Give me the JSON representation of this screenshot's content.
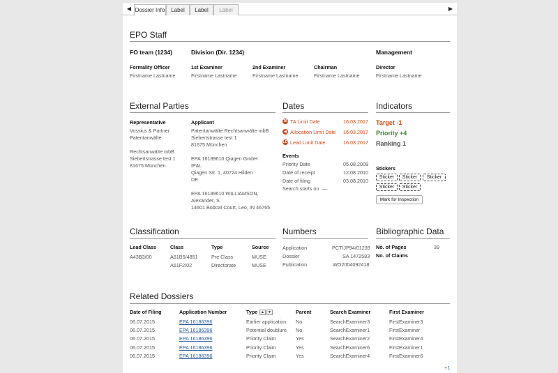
{
  "tabs": {
    "items": [
      "Dossier Info",
      "Label",
      "Label",
      "Label"
    ]
  },
  "epo_staff": {
    "heading": "EPO Staff",
    "fo_team": "FO team (1234)",
    "division": "Division (Dir. 1234)",
    "management": "Management",
    "roles": [
      {
        "role": "Formality Officer",
        "name": "Firstname Lastname"
      },
      {
        "role": "1st Examiner",
        "name": "Firstname Lastname"
      },
      {
        "role": "2nd Examiner",
        "name": "Firstname Lastname"
      },
      {
        "role": "Chairman",
        "name": "Firstname Lastname"
      },
      {
        "role": "Director",
        "name": "Firstname Lastname"
      }
    ]
  },
  "external_parties": {
    "heading": "External Parties",
    "representative": {
      "label": "Representative",
      "lines": [
        "Vossius & Partner",
        "Patentanwälte",
        "",
        "Rechtsanwälte mbB",
        "Siebertstrasse test 1",
        "81675 München"
      ]
    },
    "applicant": {
      "label": "Applicant",
      "lines": [
        "Patentanwälte Rechtsanwälte mbB",
        "Siebertstrasse test 1",
        "81675 München",
        "",
        "EPA 16189610 Qiagen GmbH",
        "IP&L",
        "Qiagen Str. 1, 40724 Hilden",
        "DE",
        "",
        "EPA 16189610 WILLIAMSON,",
        "Alexander, S.",
        "14601 Bobcat Court, Leo, IN 46765"
      ]
    }
  },
  "dates": {
    "heading": "Dates",
    "limits": [
      {
        "icon": "TA",
        "label": "TA Limit Date",
        "value": "16.03.2017"
      },
      {
        "icon": "◀",
        "label": "Allocation Limit Date",
        "value": "16.03.2017"
      },
      {
        "icon": "LD",
        "label": "Lead Limit Date",
        "value": "16.03.2017"
      }
    ],
    "events_label": "Events",
    "events": [
      {
        "label": "Priority Date",
        "value": "05.08.2009"
      },
      {
        "label": "Date of receipt",
        "value": "12.08.2010"
      },
      {
        "label": "Date of filing",
        "value": "03.08.2010"
      },
      {
        "label": "Search starts on",
        "value": "—"
      }
    ]
  },
  "indicators": {
    "heading": "Indicators",
    "target": "Target -1",
    "priority": "Priority +4",
    "ranking": "Ranking 1",
    "stickers_label": "Stickers",
    "stickers": [
      "Sticker",
      "Sticker",
      "Sticker",
      "Sticker",
      "Sticker"
    ],
    "mark_button": "Mark for Inspection"
  },
  "classification": {
    "heading": "Classification",
    "columns": [
      "Lead Class",
      "Class",
      "Type",
      "Source"
    ],
    "lead_class": "A43B3/00",
    "rows": [
      {
        "class": "A61B5/4851",
        "type": "Pre Class",
        "source": "MUSE"
      },
      {
        "class": "A61F2/02",
        "type": "Directorate",
        "source": "MUSE"
      }
    ]
  },
  "numbers": {
    "heading": "Numbers",
    "rows": [
      {
        "label": "Application",
        "value": "PCT/JP94/01239"
      },
      {
        "label": "Dossier",
        "value": "SA 1472583"
      },
      {
        "label": "Publication",
        "value": "WO2004092418"
      }
    ]
  },
  "bibliographic": {
    "heading": "Bibliographic Data",
    "rows": [
      {
        "label": "No. of Pages",
        "value": "39"
      },
      {
        "label": "No. of Claims",
        "value": ""
      }
    ]
  },
  "related": {
    "heading": "Related Dossiers",
    "columns": [
      "Date of Filing",
      "Application Number",
      "Type",
      "Parent",
      "Search Examiner",
      "First Examiner"
    ],
    "rows": [
      [
        "06.07.2015",
        "EPA 16186396",
        "Earlier application",
        "No",
        "SearchExaminer3",
        "FirstExaminer3"
      ],
      [
        "06.07.2015",
        "EPA 16186396",
        "Potential doublure",
        "No",
        "SearchExaminer1",
        "FirstExaminer"
      ],
      [
        "06.07.2015",
        "EPA 16186396",
        "Priority Claim",
        "Yes",
        "SearchExaminer2",
        "FirstExaminer4"
      ],
      [
        "06.07.2015",
        "EPA 16186396",
        "Priority Claim",
        "Yes",
        "SearchExaminer6",
        "FirstExaminer1"
      ],
      [
        "06.07.2015",
        "EPA 16186396",
        "Priority Claim",
        "Yes",
        "SearchExaminer4",
        "FirstExaminer6"
      ]
    ],
    "more": "+1"
  },
  "colors": {
    "accent_orange": "#d04a1a",
    "accent_green": "#3d8b2e",
    "link_blue": "#2a5d9f"
  }
}
